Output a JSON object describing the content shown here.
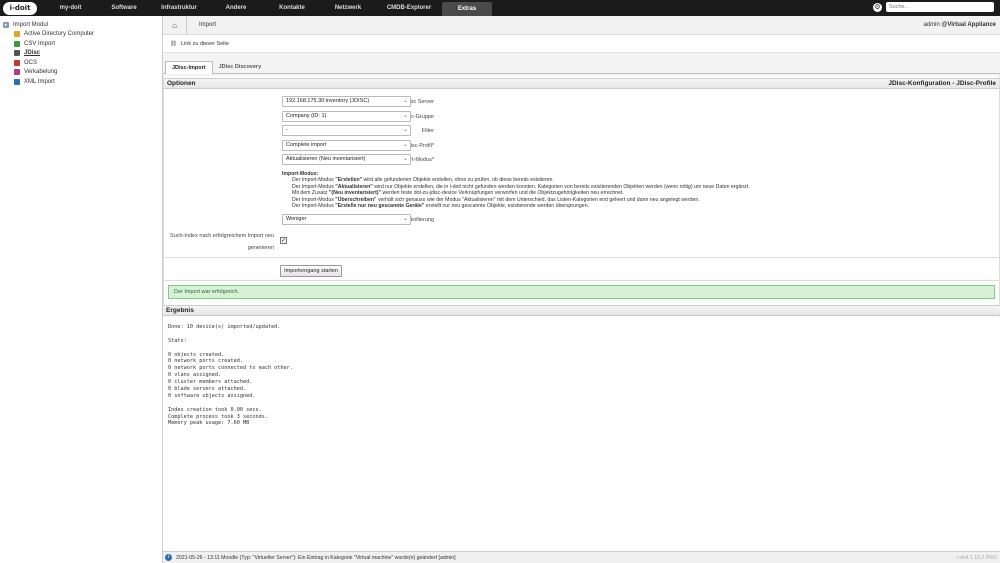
{
  "app": {
    "logo_text": "i-doit",
    "nav": [
      "my-doit",
      "Software",
      "Infrastruktur",
      "Andere",
      "Kontakte",
      "Netzwerk",
      "CMDB-Explorer",
      "Extras"
    ],
    "active_nav": "Extras",
    "search_placeholder": "Suche..."
  },
  "tree": {
    "root": "Import Modul",
    "items": [
      "Active Directory Computer",
      "CSV Import",
      "JDisc",
      "OCS",
      "Verkabelung",
      "XML Import"
    ],
    "selected": "JDisc"
  },
  "breadcrumb": {
    "current": "Import"
  },
  "user": {
    "name": "admin",
    "tenant": "@Virtual Appliance"
  },
  "permalink": "Link zu dieser Seite",
  "tabs": [
    "JDisc-Import",
    "JDisc Discovery"
  ],
  "options": {
    "title": "Optionen",
    "subtitle": "JDisc-Konfiguration - JDisc-Profile",
    "fields": [
      {
        "label": "JDisc Server",
        "required": false,
        "value": "192.168.175.30:inventory (JDISC)"
      },
      {
        "label": "JDisc-Gruppe",
        "required": false,
        "value": "Company (ID: 1)"
      },
      {
        "label": "Filter",
        "required": false,
        "value": "-"
      },
      {
        "label": "JDisc-Profil",
        "required": true,
        "value": "Complete import"
      },
      {
        "label": "Import-Modus",
        "required": true,
        "value": "Aktualisieren (Neu inventarisiert)"
      }
    ],
    "mode_help_title": "Import-Modus:",
    "mode_help": [
      {
        "pre": "Der Import-Modus ",
        "bold": "\"Erstellen\"",
        "post": " wird alle gefundenen Objekte erstellen, ohne zu prüfen, ob diese bereits existieren."
      },
      {
        "pre": "Der Import-Modus ",
        "bold": "\"Aktualisieren\"",
        "post": " wird nur Objekte erstellen, die in i-doit nicht gefunden werden konnten. Kategorien von bereits existierenden Objekten werden (wenn nötig) um neue Daten ergänzt."
      },
      {
        "pre": "Mit dem Zusatz ",
        "bold": "\"(Neu inventarisiert)\"",
        "post": " werden feste dot-zu-jdisc-device Verknüpfungen verworfen und die Objektzugehörigkeiten neu errechnet."
      },
      {
        "pre": "Der Import-Modus ",
        "bold": "\"Überschreiben\"",
        "post": " verhält sich genauso wie der Modus \"Aktualisieren\" mit dem Unterschied, das Listen-Kategorien erst geleert und dann neu angelegt werden."
      },
      {
        "pre": "Der Import-Modus ",
        "bold": "\"Erstelle nur neu gescannte Geräte\"",
        "post": " erstellt nur neu gescannte Objekte, existierende werden übersprungen."
      }
    ],
    "logging_label": "Protokollierung",
    "logging_value": "Weniger",
    "search_index_label_1": "Such-Index nach erfolgreichem Import neu",
    "search_index_label_2": "generieren",
    "search_index_checked": true,
    "start_button": "Importvorgang starten"
  },
  "success_message": "Der Import war erfolgreich.",
  "result": {
    "title": "Ergebnis",
    "lines": [
      "Done: 10 device(s) imported/updated.",
      "",
      "Stats:",
      "",
      "0 objects created.",
      "0 network ports created.",
      "0 network ports connected to each other.",
      "0 vlans assigned.",
      "0 cluster members attached.",
      "0 blade servers attached.",
      "0 software objects assigned.",
      "",
      "Index creation took 0.00 secs.",
      "Complete process took 3 seconds.",
      "Memory peak usage: 7.60 MB"
    ]
  },
  "status": {
    "text": "2021-05-26 - 13:11 Moodle (Typ: \"Virtueller Server\"): Ein Eintrag in Kategorie \"Virtual machine\" wurde(n) geändert [admin]",
    "version": "i-doit 1.16.2 PRO"
  }
}
